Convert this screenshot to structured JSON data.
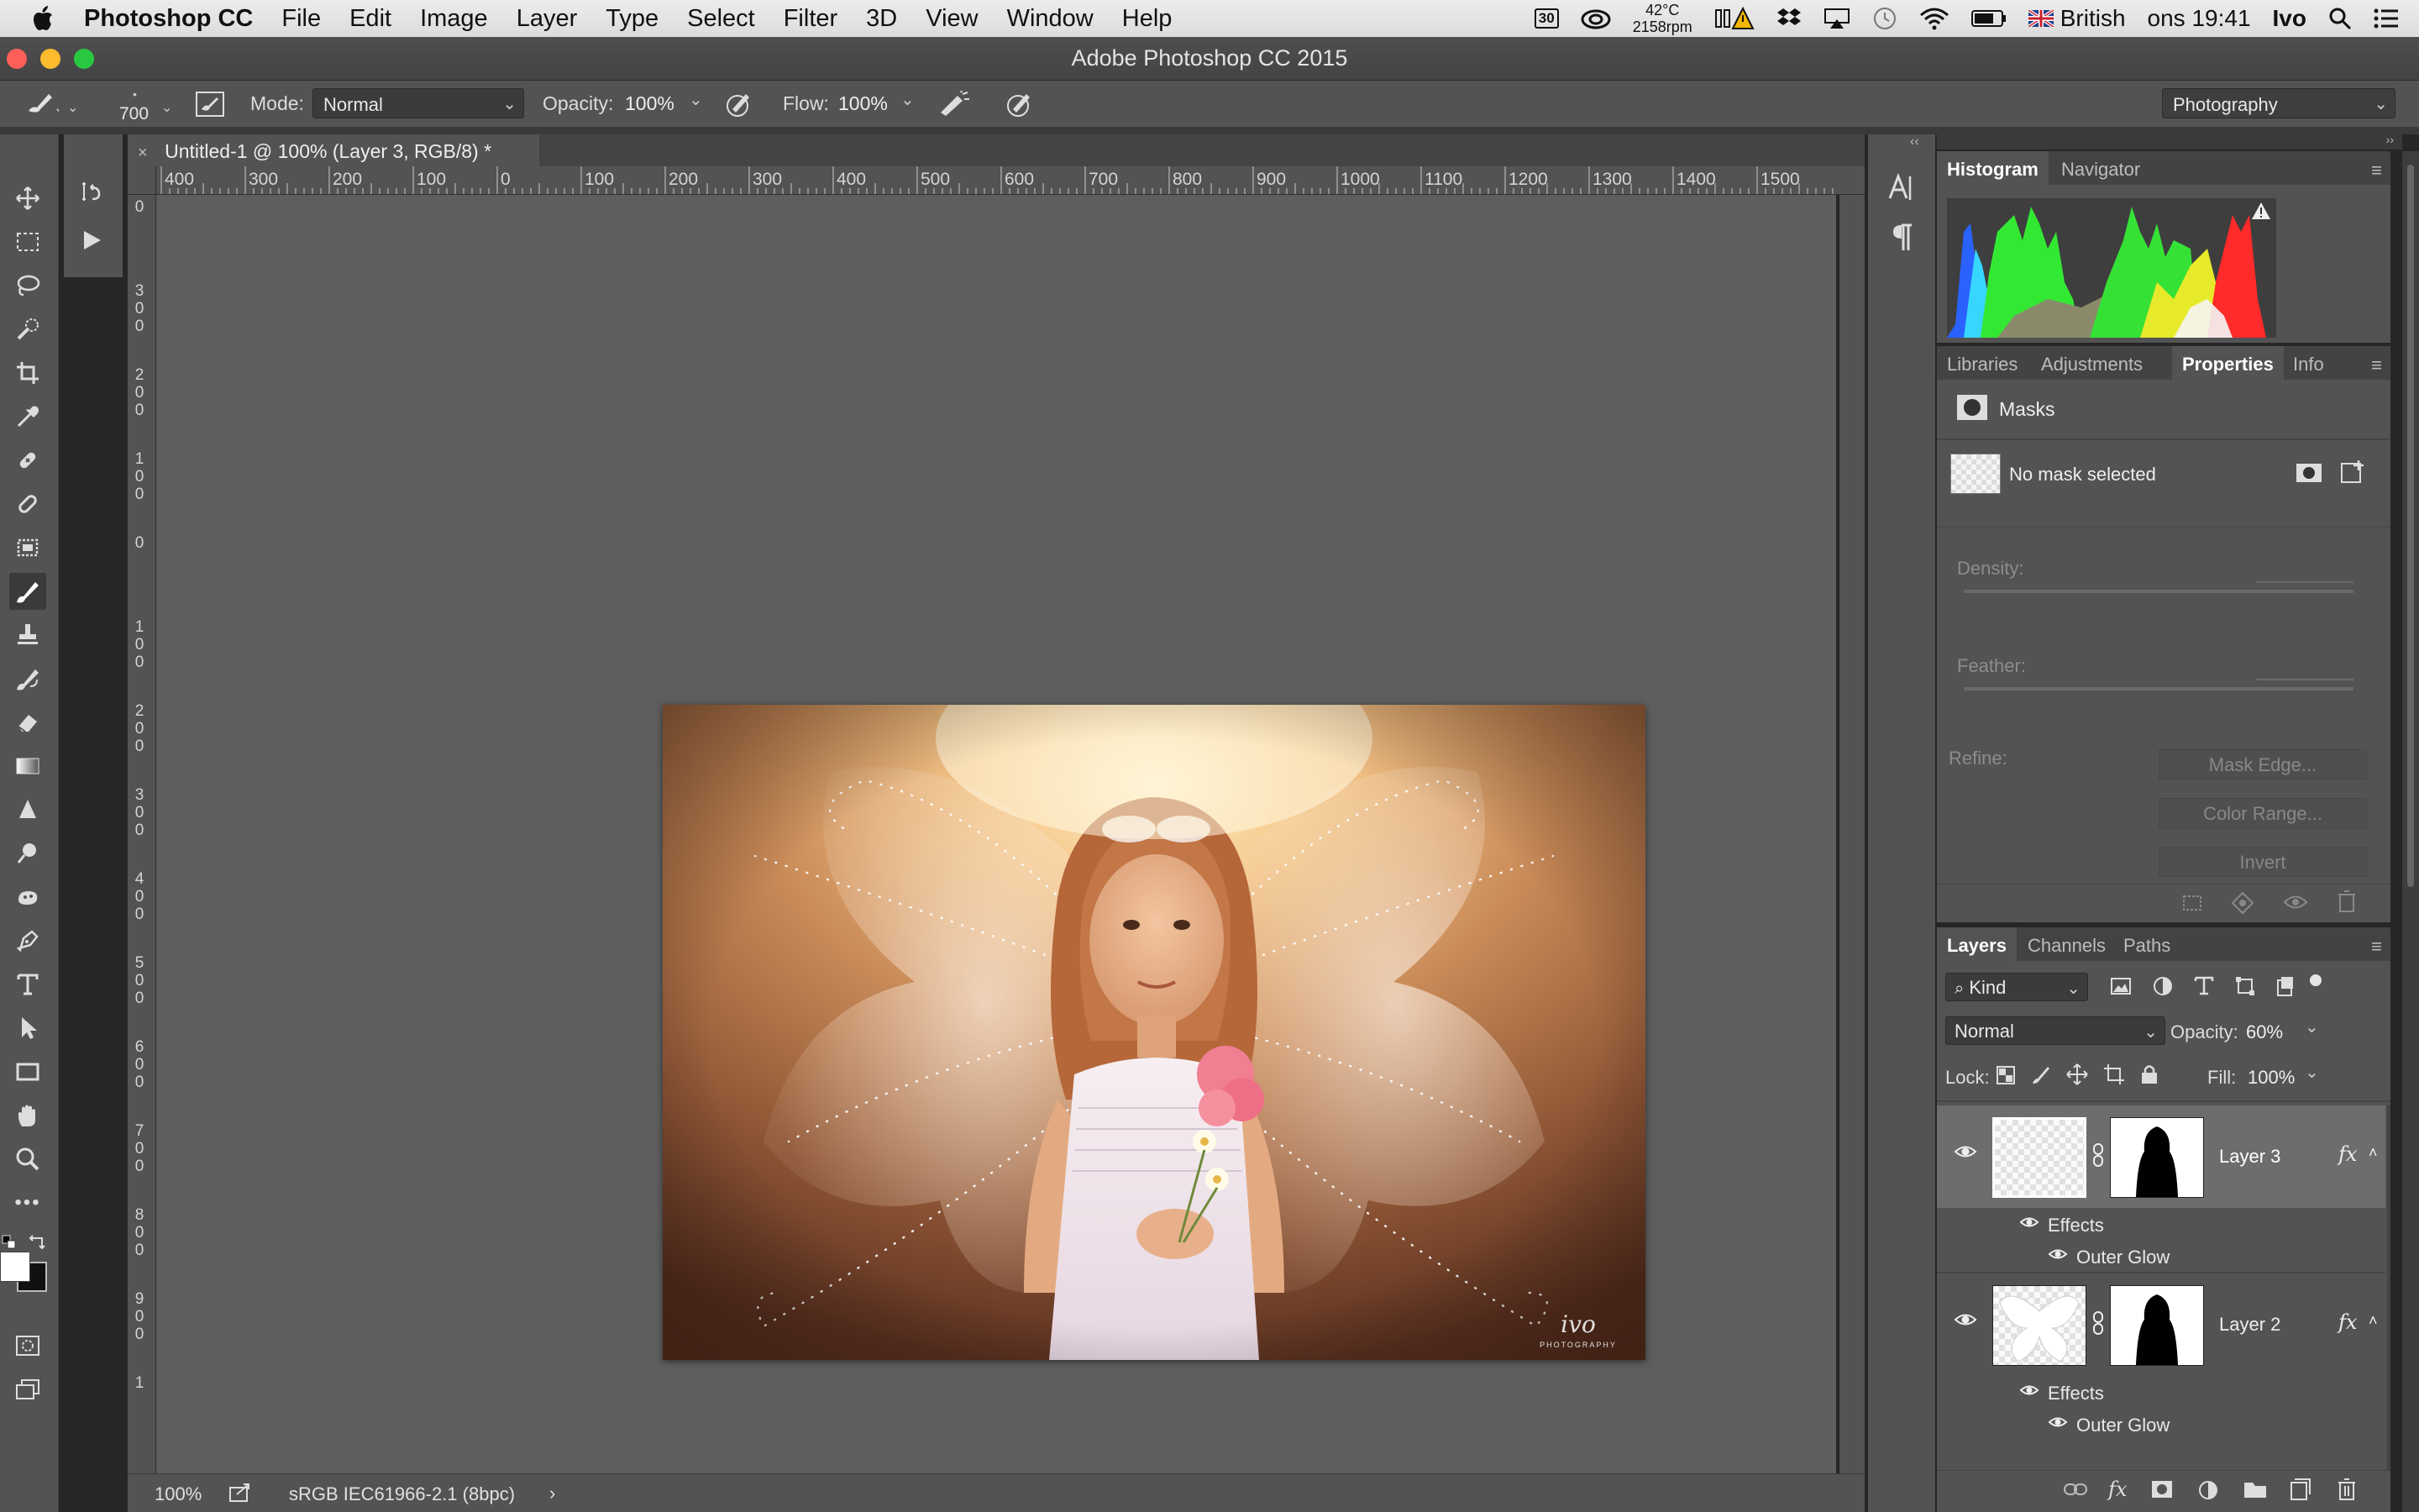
{
  "menubar": {
    "app_name": "Photoshop CC",
    "items": [
      "File",
      "Edit",
      "Image",
      "Layer",
      "Type",
      "Select",
      "Filter",
      "3D",
      "View",
      "Window",
      "Help"
    ],
    "status": {
      "calendar_day": "30",
      "temperature": "42°C",
      "fan": "2158rpm",
      "input_source": "British",
      "clock": "ons 19:41",
      "user": "Ivo"
    }
  },
  "window": {
    "title": "Adobe Photoshop CC 2015"
  },
  "options_bar": {
    "brush_size": "700",
    "mode_label": "Mode:",
    "mode_value": "Normal",
    "opacity_label": "Opacity:",
    "opacity_value": "100%",
    "flow_label": "Flow:",
    "flow_value": "100%",
    "workspace": "Photography"
  },
  "document": {
    "tab_title": "Untitled-1 @ 100% (Layer 3, RGB/8) *",
    "ruler_h": [
      "400",
      "300",
      "200",
      "100",
      "0",
      "100",
      "200",
      "300",
      "400",
      "500",
      "600",
      "700",
      "800",
      "900",
      "1000",
      "1100",
      "1200",
      "1300",
      "1400",
      "1500"
    ],
    "ruler_v": [
      "0",
      "300",
      "200",
      "100",
      "0",
      "100",
      "200",
      "300",
      "400",
      "500",
      "600",
      "700",
      "800",
      "900",
      "1"
    ],
    "watermark_main": "ivo",
    "watermark_sub": "PHOTOGRAPHY"
  },
  "status_bar": {
    "zoom": "100%",
    "profile": "sRGB IEC61966-2.1 (8bpc)",
    "arrow": "›"
  },
  "histogram_panel": {
    "tabs": [
      "Histogram",
      "Navigator"
    ],
    "active_tab": "Histogram"
  },
  "properties_panel": {
    "tabs": [
      "Libraries",
      "Adjustments",
      "Properties",
      "Info"
    ],
    "active_tab": "Properties",
    "section": "Masks",
    "mask_status": "No mask selected",
    "density_label": "Density:",
    "feather_label": "Feather:",
    "refine_label": "Refine:",
    "buttons": [
      "Mask Edge...",
      "Color Range...",
      "Invert"
    ]
  },
  "layers_panel": {
    "tabs": [
      "Layers",
      "Channels",
      "Paths"
    ],
    "active_tab": "Layers",
    "filter_kind": "Kind",
    "blend_mode": "Normal",
    "opacity_label": "Opacity:",
    "opacity_value": "60%",
    "lock_label": "Lock:",
    "fill_label": "Fill:",
    "fill_value": "100%",
    "layers": [
      {
        "name": "Layer 3",
        "fx": "fx",
        "effects_label": "Effects",
        "effect": "Outer Glow",
        "selected": true
      },
      {
        "name": "Layer 2",
        "fx": "fx",
        "effects_label": "Effects",
        "effect": "Outer Glow",
        "selected": false
      }
    ]
  },
  "colors": {
    "ui_panel": "#535353",
    "canvas_bg": "#5e5e5e",
    "menubar": "#e6e6e6",
    "close": "#fc5f57",
    "minimize": "#fdbc2e",
    "zoom": "#28c840"
  }
}
